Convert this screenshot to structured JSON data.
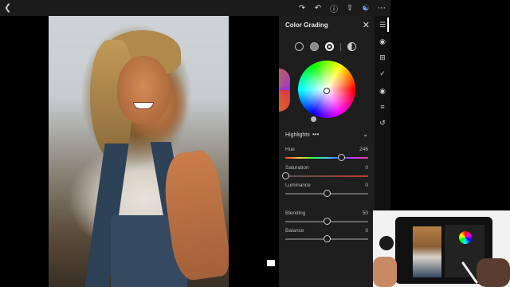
{
  "toolbar": {
    "back_icon": "chevron-left-icon",
    "icons": [
      "redo-icon",
      "undo-icon",
      "help-icon",
      "share-icon",
      "people-icon",
      "more-icon"
    ]
  },
  "panel": {
    "title": "Color Grading",
    "modes": [
      "three-way-icon",
      "shadows-icon",
      "highlights-icon",
      "global-icon"
    ],
    "section": "Highlights",
    "sliders": {
      "hue": {
        "label": "Hue",
        "value": "246",
        "fraction": 0.68
      },
      "saturation": {
        "label": "Saturation",
        "value": "0",
        "fraction": 0.0
      },
      "luminance": {
        "label": "Luminance",
        "value": "0",
        "fraction": 0.5
      },
      "blending": {
        "label": "Blending",
        "value": "50",
        "fraction": 0.5
      },
      "balance": {
        "label": "Balance",
        "value": "0",
        "fraction": 0.5
      }
    }
  },
  "right_toolbar": [
    "sliders-icon",
    "color-icon",
    "crop-icon",
    "healing-icon",
    "masking-icon",
    "presets-icon",
    "history-icon"
  ],
  "accent": "#ffffff"
}
